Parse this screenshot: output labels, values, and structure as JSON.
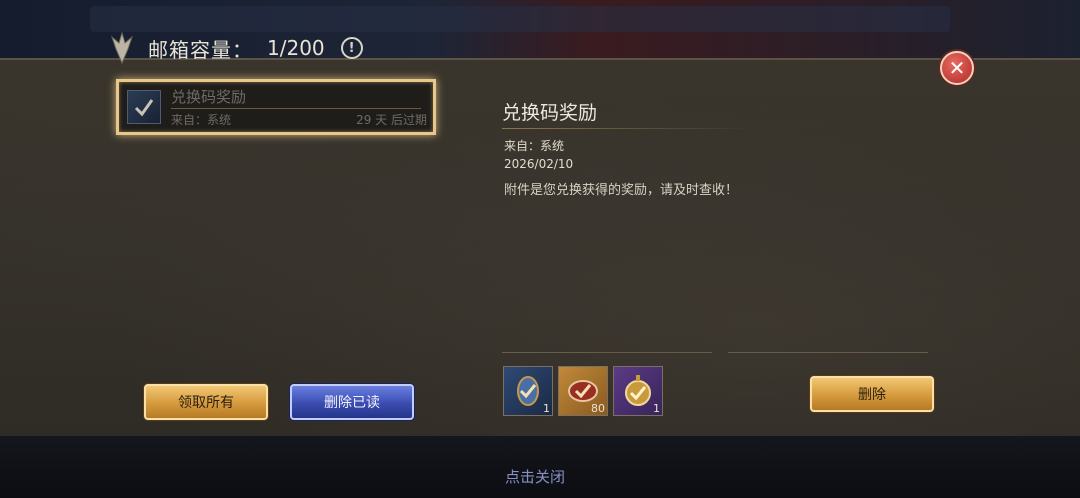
{
  "header": {
    "title": "邮箱容量：",
    "count": "1/200",
    "info_glyph": "!"
  },
  "close_glyph": "✕",
  "mail_list": [
    {
      "subject": "兑换码奖励",
      "from": "来自：系统",
      "expiry": "29 天 后过期",
      "selected": true
    }
  ],
  "buttons": {
    "claim_all": "领取所有",
    "delete_read": "删除已读",
    "delete": "删除"
  },
  "detail": {
    "title": "兑换码奖励",
    "from": "来自：系统",
    "date": "2026/02/10",
    "body": "附件是您兑换获得的奖励，请及时查收！"
  },
  "attachments": [
    {
      "icon": "blue-amulet-icon",
      "qty": "1",
      "rarity_color": "#2e4a74"
    },
    {
      "icon": "meat-icon",
      "qty": "80",
      "rarity_color": "#c08a3a"
    },
    {
      "icon": "gold-pocket-watch-icon",
      "qty": "1",
      "rarity_color": "#5c3b86"
    }
  ],
  "footer": {
    "close_hint": "点击关闭"
  },
  "colors": {
    "gold": "#e9c78a",
    "accent_blue": "#3a4cb0",
    "close_red": "#c0302a"
  }
}
